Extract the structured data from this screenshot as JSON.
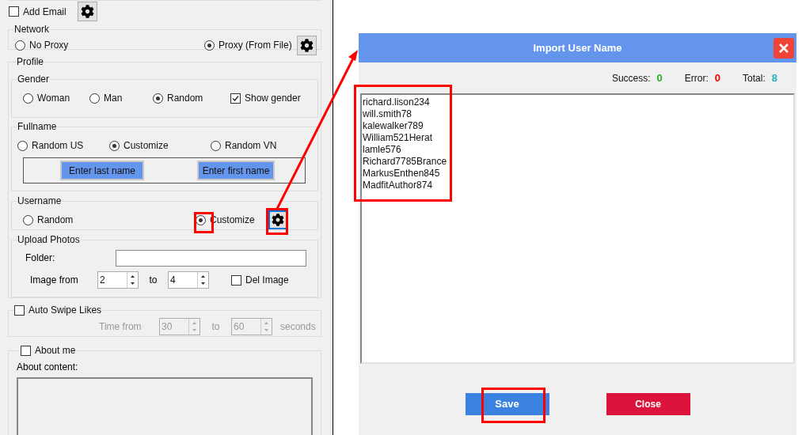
{
  "add_email": {
    "label": "Add Email",
    "checked": false
  },
  "network": {
    "title": "Network",
    "options": [
      {
        "label": "No Proxy",
        "selected": false
      },
      {
        "label": "Proxy (From File)",
        "selected": true
      }
    ]
  },
  "profile": {
    "title": "Profile",
    "gender": {
      "title": "Gender",
      "options": [
        {
          "label": "Woman",
          "selected": false
        },
        {
          "label": "Man",
          "selected": false
        },
        {
          "label": "Random",
          "selected": true
        }
      ],
      "show_gender": {
        "label": "Show gender",
        "checked": true
      }
    },
    "fullname": {
      "title": "Fullname",
      "options": [
        {
          "label": "Random US",
          "selected": false
        },
        {
          "label": "Customize",
          "selected": true
        },
        {
          "label": "Random VN",
          "selected": false
        }
      ],
      "buttons": [
        "Enter last name",
        "Enter first name"
      ]
    },
    "username": {
      "title": "Username",
      "options": [
        {
          "label": "Random",
          "selected": false
        },
        {
          "label": "Customize",
          "selected": true
        }
      ]
    },
    "upload_photos": {
      "title": "Upload Photos",
      "folder_label": "Folder:",
      "image_from_label": "Image from",
      "from": "2",
      "to_label": "to",
      "to": "4",
      "del_image": {
        "label": "Del Image",
        "checked": false
      }
    }
  },
  "auto_swipe": {
    "label": "Auto Swipe  Likes",
    "checked": false,
    "disabled": true,
    "time_from_label": "Time from",
    "from": "30",
    "to_label": "to",
    "to": "60",
    "unit": "seconds"
  },
  "about_me": {
    "label": "About me",
    "checked": false,
    "content_label": "About content:"
  },
  "dialog": {
    "title": "Import User Name",
    "stats": [
      {
        "label": "Success:",
        "value": "0",
        "color": "#22b522"
      },
      {
        "label": "Error:",
        "value": "0",
        "color": "#ff0000"
      },
      {
        "label": "Total:",
        "value": "8",
        "color": "#20b2c0"
      }
    ],
    "names": [
      "richard.lison234",
      "will.smith78",
      "kalewalker789",
      "William521Herat",
      "lamle576",
      "Richard7785Brance",
      "MarkusEnthen845",
      "MadfitAuthor874"
    ],
    "buttons": [
      {
        "label": "Save",
        "kind": "primary"
      },
      {
        "label": "Close",
        "kind": "danger"
      }
    ]
  }
}
